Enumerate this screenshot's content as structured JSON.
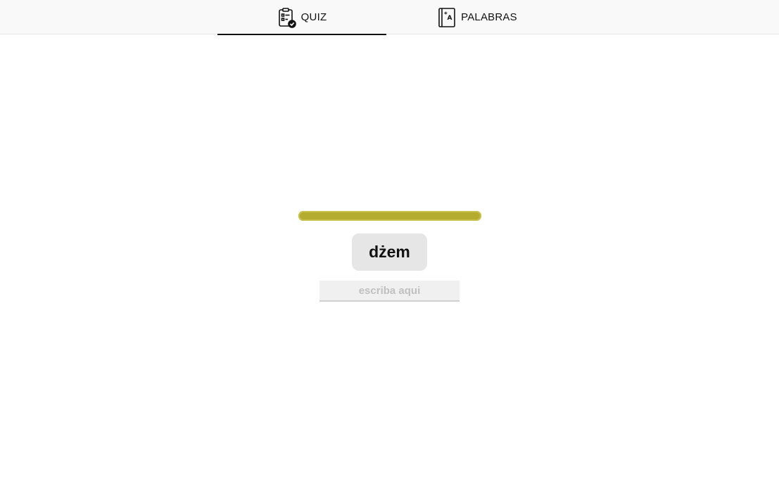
{
  "tabs": [
    {
      "label": "QUIZ",
      "icon": "clipboard-check-icon",
      "active": true
    },
    {
      "label": "PALABRAS",
      "icon": "dictionary-book-icon",
      "active": false
    }
  ],
  "quiz": {
    "progress_fraction": 1.0,
    "progress_color": "#b4ac2e",
    "word": "dżem",
    "answer_value": "",
    "answer_placeholder": "escriba aqui"
  }
}
